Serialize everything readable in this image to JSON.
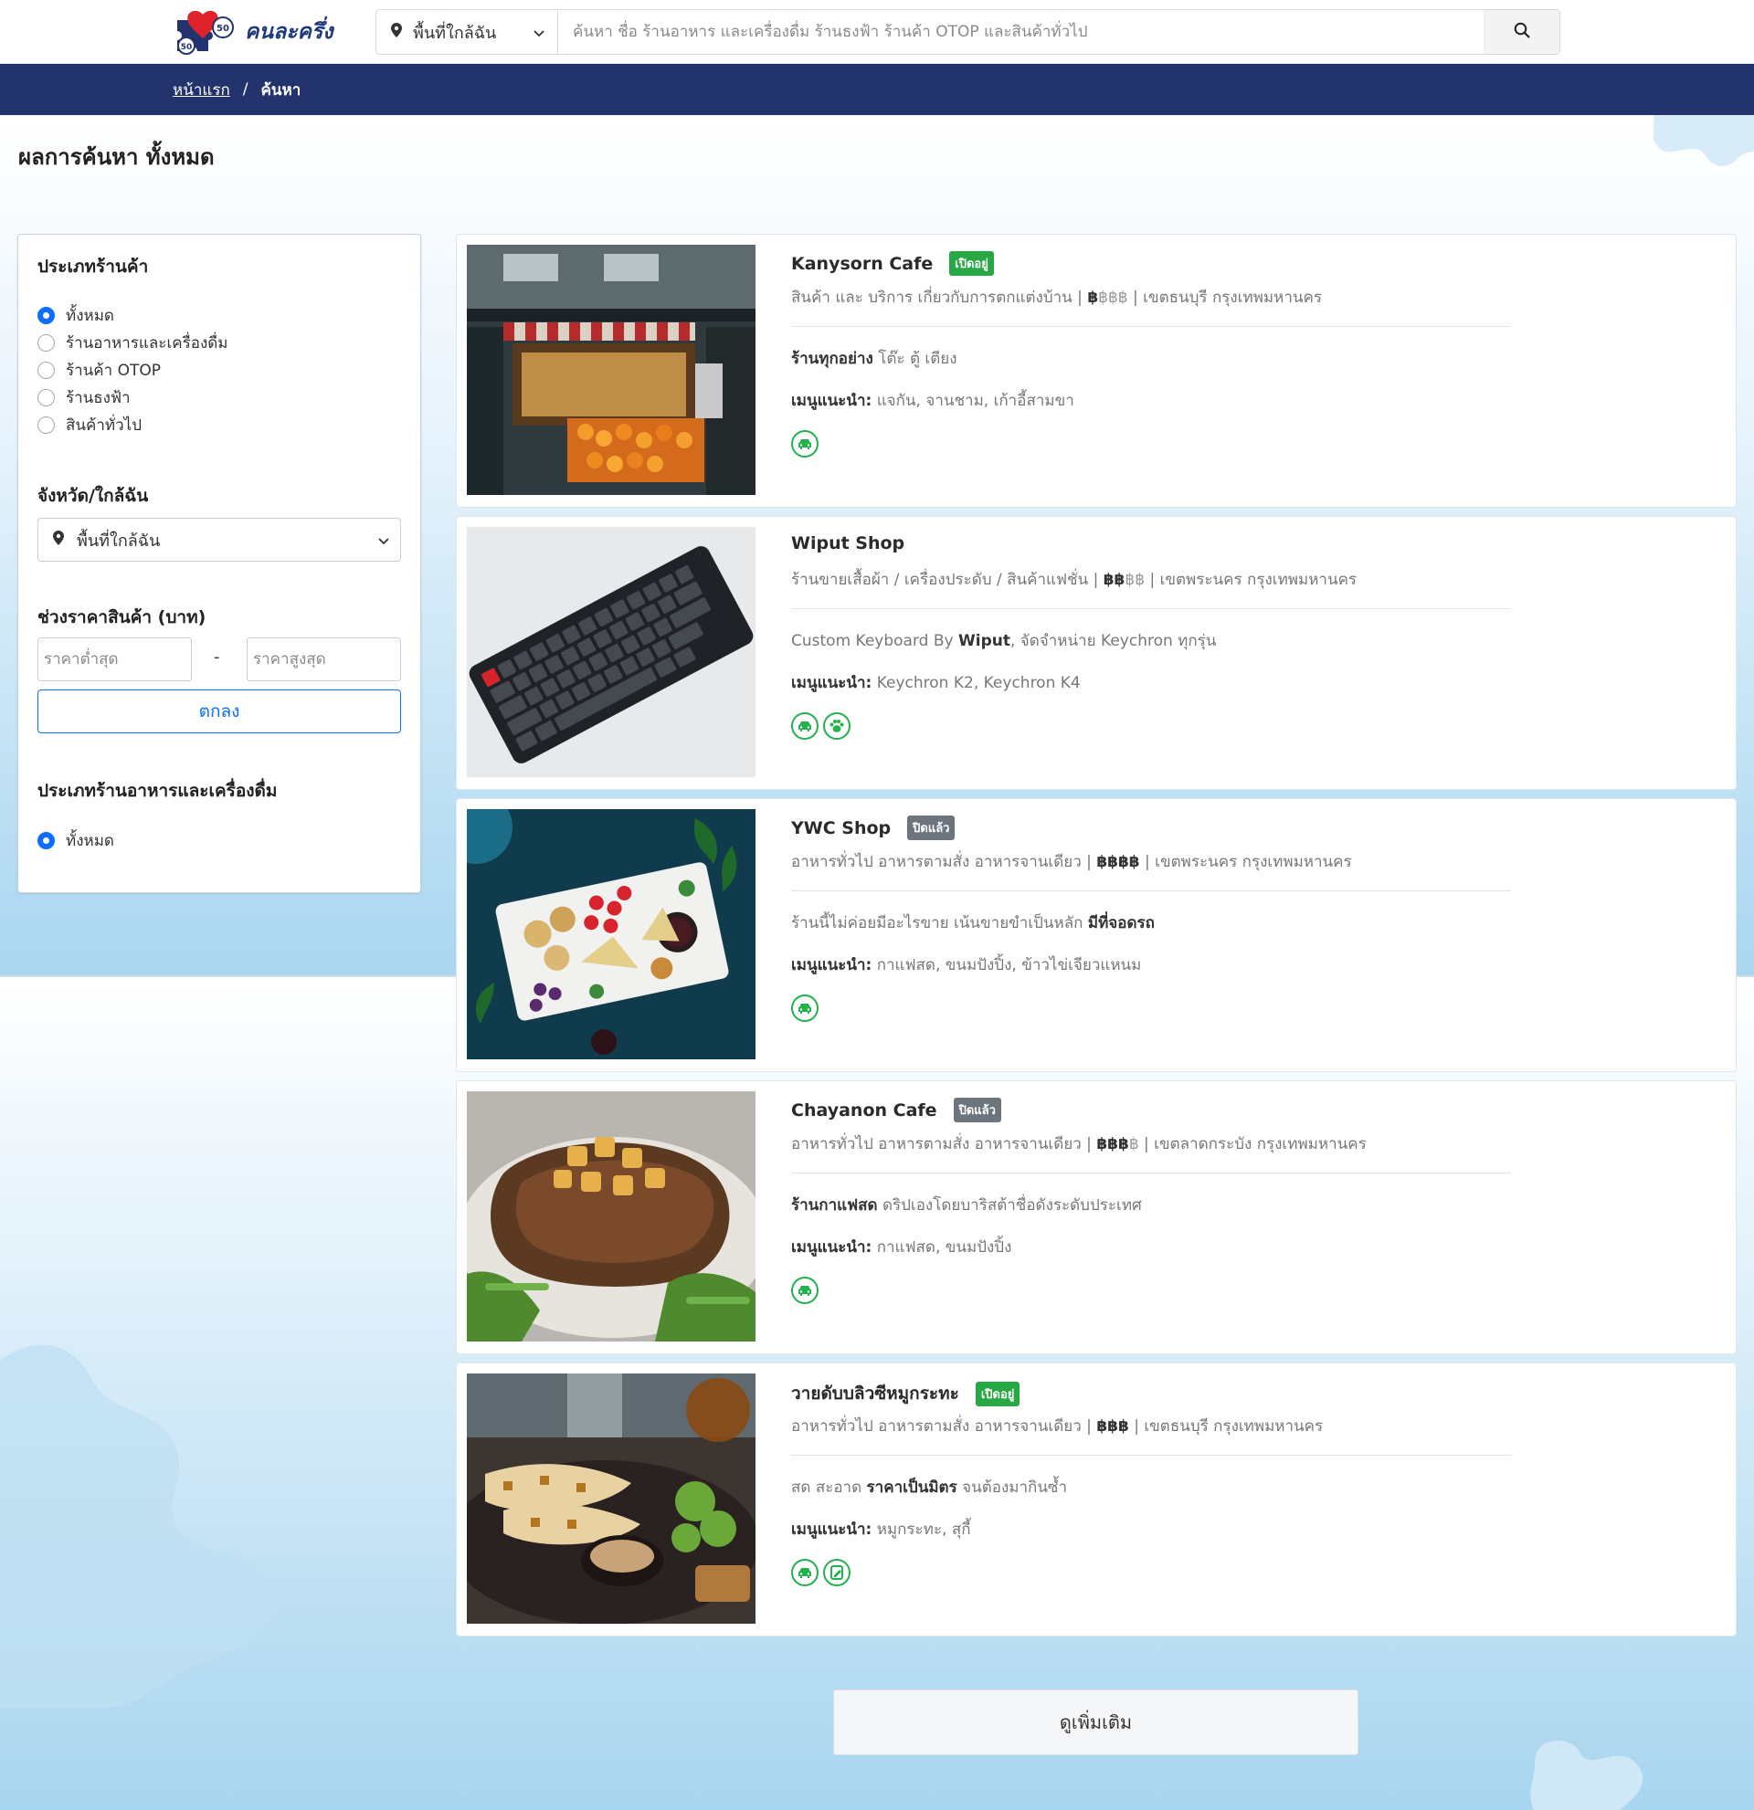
{
  "header": {
    "logo_text": "คนละครึ่ง",
    "logo_badge": "50",
    "location_label": "พื้นที่ใกล้ฉัน",
    "search_placeholder": "ค้นหา ชื่อ ร้านอาหาร และเครื่องดื่ม ร้านธงฟ้า ร้านค้า OTOP และสินค้าทั่วไป"
  },
  "breadcrumb": {
    "home": "หน้าแรก",
    "separator": "/",
    "current": "ค้นหา"
  },
  "page_title": "ผลการค้นหา ทั้งหมด",
  "sidebar": {
    "shop_type_title": "ประเภทร้านค้า",
    "shop_types": [
      {
        "label": "ทั้งหมด",
        "selected": true
      },
      {
        "label": "ร้านอาหารและเครื่องดื่ม",
        "selected": false
      },
      {
        "label": "ร้านค้า OTOP",
        "selected": false
      },
      {
        "label": "ร้านธงฟ้า",
        "selected": false
      },
      {
        "label": "สินค้าทั่วไป",
        "selected": false
      }
    ],
    "province_title": "จังหวัด/ใกล้ฉัน",
    "province_value": "พื้นที่ใกล้ฉัน",
    "price_title": "ช่วงราคาสินค้า (บาท)",
    "price_min_placeholder": "ราคาต่ำสุด",
    "price_max_placeholder": "ราคาสูงสุด",
    "price_dash": "-",
    "ok_label": "ตกลง",
    "food_type_title": "ประเภทร้านอาหารและเครื่องดื่ม",
    "food_types": [
      {
        "label": "ทั้งหมด",
        "selected": true
      }
    ]
  },
  "results": [
    {
      "name": "Kanysorn Cafe",
      "status": "เปิดอยู่",
      "status_kind": "open",
      "category": "สินค้า และ บริการ เกี่ยวกับการตกแต่งบ้าน |",
      "price_on": "฿",
      "price_off": "฿฿฿",
      "location": "| เขตธนบุรี กรุงเทพมหานคร",
      "desc_bold": "ร้านทุกอย่าง",
      "desc_rest": " โต๊ะ ตู้ เตียง",
      "menu_label": "เมนูแนะนำ:",
      "menu_items": " แจกัน, จานชาม, เก้าอี้สามขา",
      "services": [
        "car-icon"
      ]
    },
    {
      "name": "Wiput Shop",
      "status": "",
      "status_kind": "",
      "category": "ร้านขายเสื้อผ้า / เครื่องประดับ / สินค้าแฟชั่น |",
      "price_on": "฿฿",
      "price_off": "฿฿",
      "location": "| เขตพระนคร กรุงเทพมหานคร",
      "desc_pre": "Custom Keyboard By ",
      "desc_bold": "Wiput",
      "desc_rest": ", จัดจำหน่าย Keychron ทุกรุ่น",
      "menu_label": "เมนูแนะนำ:",
      "menu_items": " Keychron K2, Keychron K4",
      "services": [
        "car-icon",
        "paw-icon"
      ]
    },
    {
      "name": "YWC Shop",
      "status": "ปิดแล้ว",
      "status_kind": "closed",
      "category": "อาหารทั่วไป อาหารตามสั่ง อาหารจานเดียว |",
      "price_on": "฿฿฿฿",
      "price_off": "",
      "location": "| เขตพระนคร กรุงเทพมหานคร",
      "desc_pre": "ร้านนี้ไม่ค่อยมีอะไรขาย เน้นขายขำเป็นหลัก ",
      "desc_bold": "มีที่จอดรถ",
      "desc_rest": "",
      "menu_label": "เมนูแนะนำ:",
      "menu_items": " กาแฟสด, ขนมปังปิ้ง, ข้าวไข่เจียวแหนม",
      "services": [
        "car-icon"
      ]
    },
    {
      "name": "Chayanon Cafe",
      "status": "ปิดแล้ว",
      "status_kind": "closed",
      "category": "อาหารทั่วไป อาหารตามสั่ง อาหารจานเดียว |",
      "price_on": "฿฿฿",
      "price_off": "฿",
      "location": "| เขตลาดกระบัง กรุงเทพมหานคร",
      "desc_bold": "ร้านกาแฟสด",
      "desc_rest": " ดริปเองโดยบาริสต้าชื่อดังระดับประเทศ",
      "menu_label": "เมนูแนะนำ:",
      "menu_items": " กาแฟสด, ขนมปังปิ้ง",
      "services": [
        "car-icon"
      ]
    },
    {
      "name": "วายดับบลิวซีหมูกระทะ",
      "status": "เปิดอยู่",
      "status_kind": "open",
      "category": "อาหารทั่วไป อาหารตามสั่ง อาหารจานเดียว |",
      "price_on": "฿฿฿",
      "price_off": "",
      "location": "| เขตธนบุรี กรุงเทพมหานคร",
      "desc_pre": "สด สะอาด ",
      "desc_bold": "ราคาเป็นมิตร",
      "desc_rest": " จนต้องมากินซ้ำ",
      "menu_label": "เมนูแนะนำ:",
      "menu_items": " หมูกระทะ, สุกี้",
      "services": [
        "car-icon",
        "reserve-icon"
      ]
    }
  ],
  "more_label": "ดูเพิ่มเติม",
  "colors": {
    "navy": "#23336e",
    "accent_blue": "#0d6efd",
    "open_green": "#28a745",
    "closed_gray": "#6c757d",
    "service_green": "#22b14c"
  }
}
